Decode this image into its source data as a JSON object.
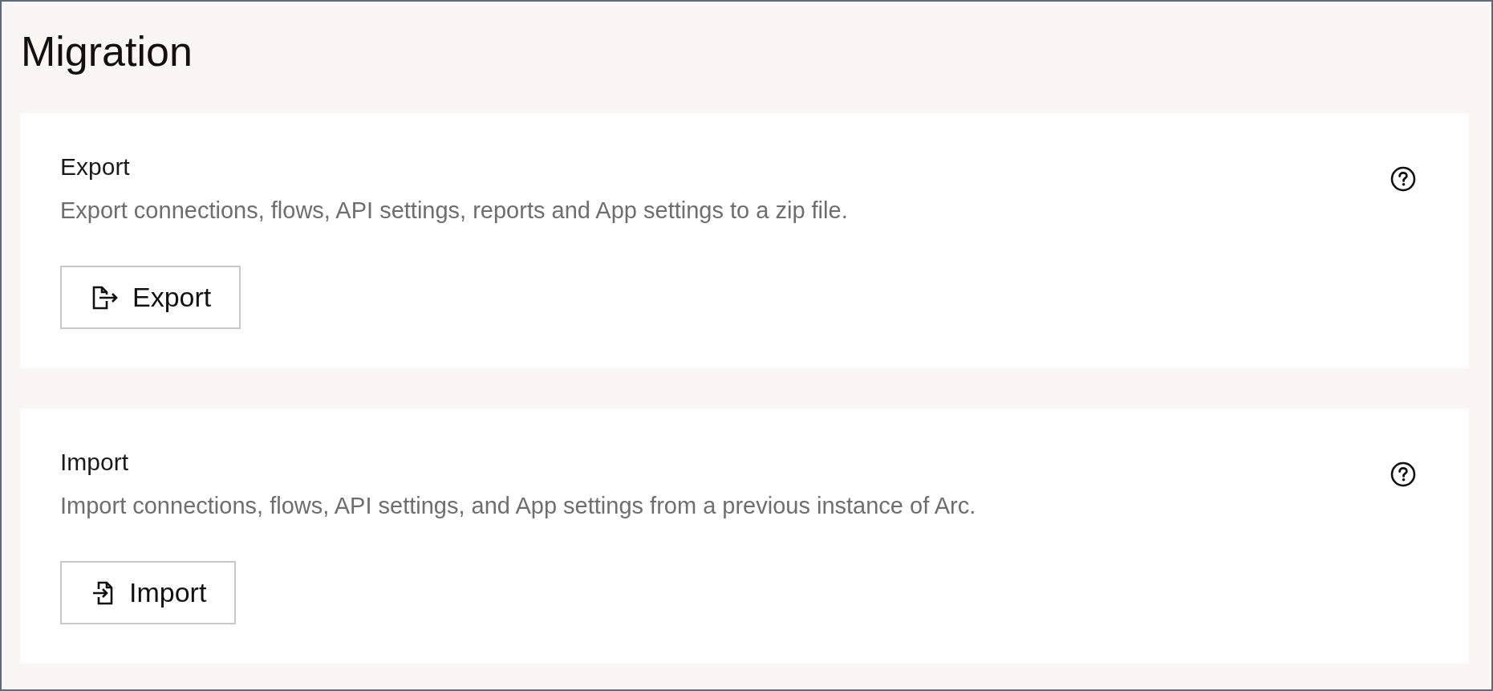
{
  "page": {
    "title": "Migration"
  },
  "sections": [
    {
      "kind": "export",
      "heading": "Export",
      "description": "Export connections, flows, API settings, reports and App settings to a zip file.",
      "button": {
        "label": "Export"
      }
    },
    {
      "kind": "import",
      "heading": "Import",
      "description": "Import connections, flows, API settings, and App settings from a previous instance of Arc.",
      "button": {
        "label": "Import"
      }
    }
  ]
}
